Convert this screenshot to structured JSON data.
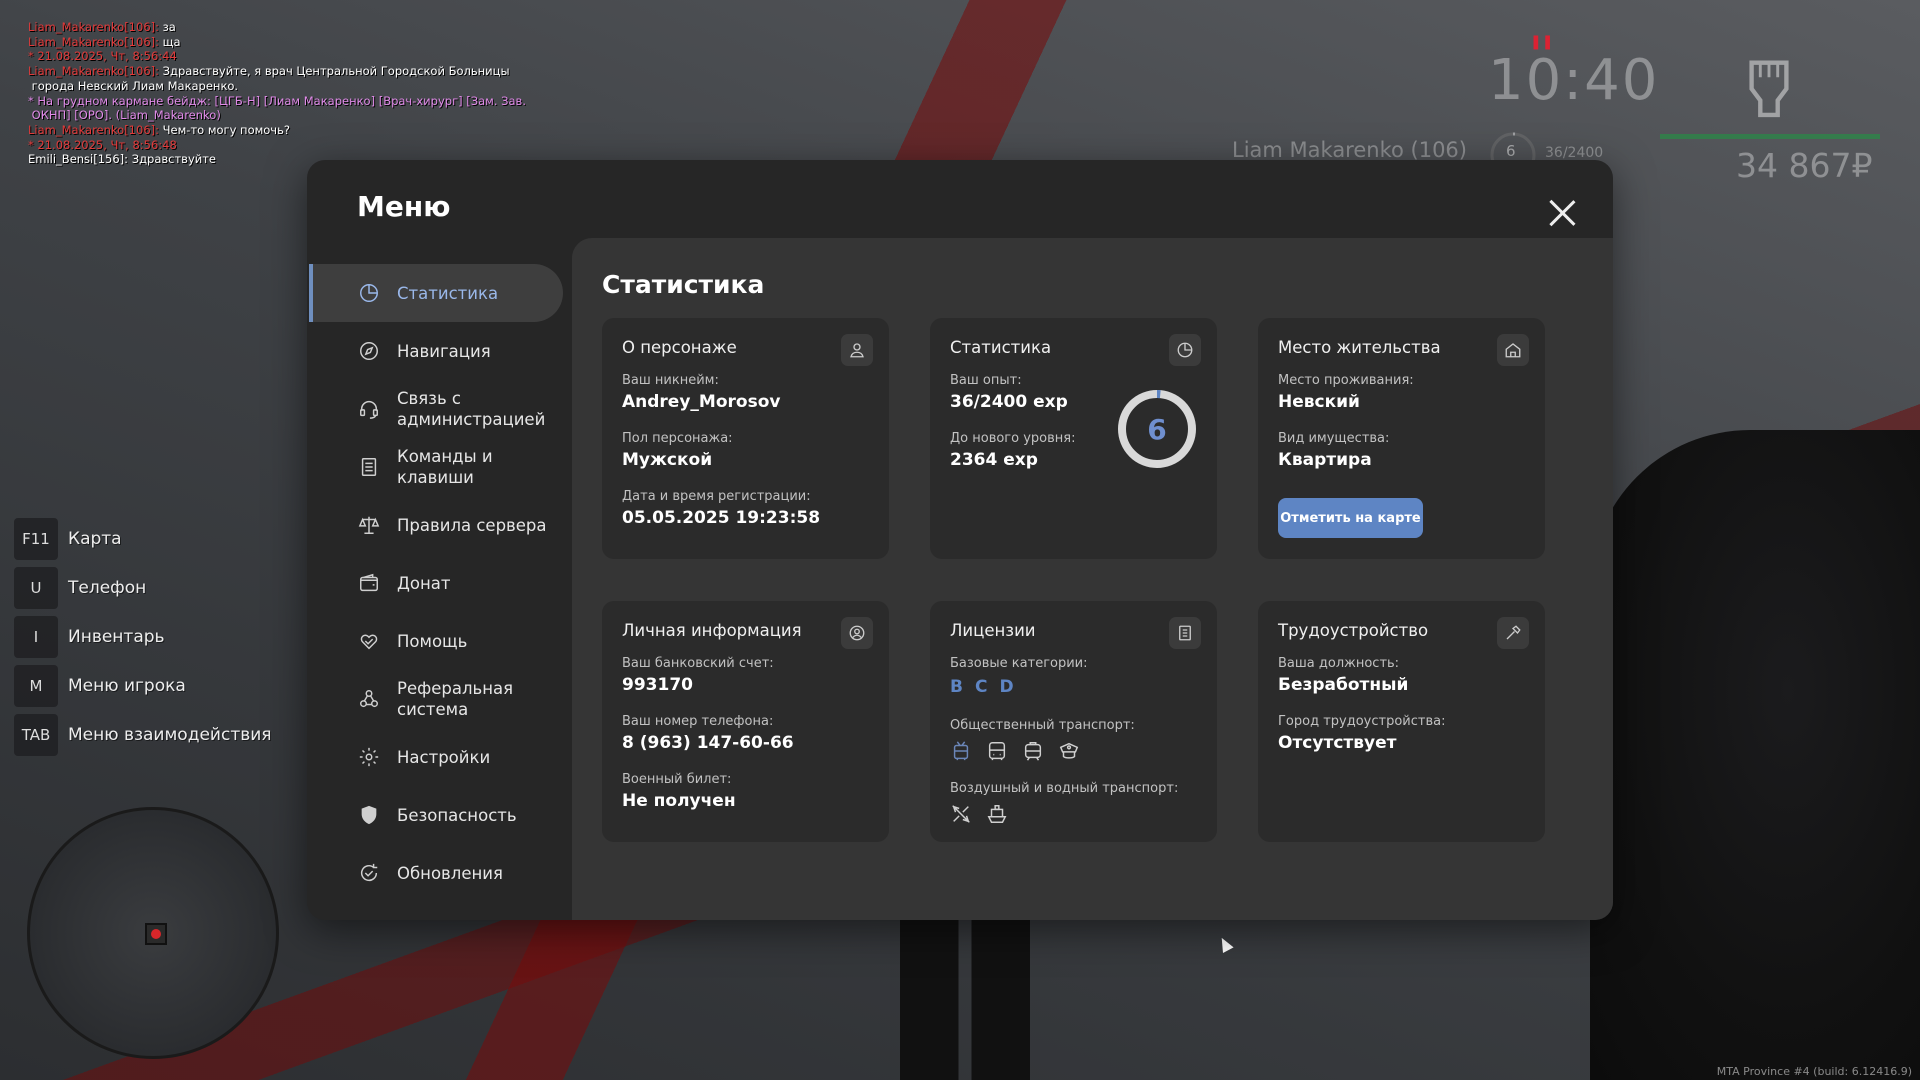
{
  "chat": [
    {
      "parts": [
        {
          "text": "Liam_Makarenko[106]: ",
          "color": "red"
        },
        {
          "text": "за",
          "color": "white"
        }
      ]
    },
    {
      "parts": [
        {
          "text": "Liam_Makarenko[106]: ",
          "color": "red"
        },
        {
          "text": "ща",
          "color": "white"
        }
      ]
    },
    {
      "parts": [
        {
          "text": "* 21.08.2025, Чт, 8:56:44",
          "color": "red"
        }
      ]
    },
    {
      "parts": [
        {
          "text": "Liam_Makarenko[106]: ",
          "color": "red"
        },
        {
          "text": "Здравствуйте, я врач Центральной Городской Больницы",
          "color": "white"
        }
      ]
    },
    {
      "parts": [
        {
          "text": " города Невский Лиам Макаренко.",
          "color": "white"
        }
      ]
    },
    {
      "parts": [
        {
          "text": "* На грудном кармане бейдж: [ЦГБ-Н] [Лиам Макаренко] [Врач-хирург] [Зам. Зав.",
          "color": "pink"
        }
      ]
    },
    {
      "parts": [
        {
          "text": " ОКНП] [ОРО]. (Liam_Makarenko)",
          "color": "pink"
        }
      ]
    },
    {
      "parts": [
        {
          "text": "Liam_Makarenko[106]: ",
          "color": "red"
        },
        {
          "text": "Чем-то могу помочь?",
          "color": "white"
        }
      ]
    },
    {
      "parts": [
        {
          "text": "* 21.08.2025, Чт, 8:56:48",
          "color": "red"
        }
      ]
    },
    {
      "parts": [
        {
          "text": "Emili_Bensi[156]: Здравствуйте",
          "color": "white"
        }
      ]
    }
  ],
  "hud": {
    "clock": "10:40",
    "player_name": "Liam Makarenko (106)",
    "level": "6",
    "exp": "36/2400",
    "money": "34 867₽"
  },
  "hotkeys": [
    {
      "key": "F11",
      "label": "Карта"
    },
    {
      "key": "U",
      "label": "Телефон"
    },
    {
      "key": "I",
      "label": "Инвентарь"
    },
    {
      "key": "M",
      "label": "Меню игрока"
    },
    {
      "key": "TAB",
      "label": "Меню взаимодействия"
    }
  ],
  "build_info": "MTA Province #4 (build: 6.12416.9)",
  "menu": {
    "title": "Меню",
    "sidebar": [
      {
        "label": "Статистика",
        "icon": "pie-chart-icon",
        "active": true
      },
      {
        "label": "Навигация",
        "icon": "compass-icon"
      },
      {
        "label": "Связь с\nадминистрацией",
        "icon": "headset-icon"
      },
      {
        "label": "Команды и\nклавиши",
        "icon": "document-list-icon"
      },
      {
        "label": "Правила сервера",
        "icon": "scales-icon"
      },
      {
        "label": "Донат",
        "icon": "wallet-icon"
      },
      {
        "label": "Помощь",
        "icon": "heart-hands-icon"
      },
      {
        "label": "Реферальная\nсистема",
        "icon": "people-network-icon"
      },
      {
        "label": "Настройки",
        "icon": "gear-icon"
      },
      {
        "label": "Безопасность",
        "icon": "shield-icon"
      },
      {
        "label": "Обновления",
        "icon": "refresh-check-icon"
      }
    ],
    "content_title": "Статистика",
    "cards": {
      "character": {
        "title": "О персонаже",
        "nickname_label": "Ваш никнейм:",
        "nickname": "Andrey_Morosov",
        "gender_label": "Пол персонажа:",
        "gender": "Мужской",
        "reg_label": "Дата и время регистрации:",
        "reg": "05.05.2025 19:23:58"
      },
      "stats": {
        "title": "Статистика",
        "exp_label": "Ваш опыт:",
        "exp": "36/2400 exp",
        "next_label": "До нового уровня:",
        "next": "2364 exp",
        "level": "6",
        "progress": 0.015
      },
      "residence": {
        "title": "Место жительства",
        "place_label": "Место проживания:",
        "place": "Невский",
        "property_label": "Вид имущества:",
        "property": "Квартира",
        "button": "Отметить на карте"
      },
      "personal": {
        "title": "Личная информация",
        "bank_label": "Ваш банковский счет:",
        "bank": "993170",
        "phone_label": "Ваш номер телефона:",
        "phone": "8 (963) 147-60-66",
        "military_label": "Военный билет:",
        "military": "Не получен"
      },
      "licenses": {
        "title": "Лицензии",
        "base_label": "Базовые категории:",
        "base": [
          "B",
          "C",
          "D"
        ],
        "public_label": "Общественный транспорт:",
        "air_label": "Воздушный и водный транспорт:"
      },
      "employment": {
        "title": "Трудоустройство",
        "position_label": "Ваша должность:",
        "position": "Безработный",
        "city_label": "Город трудоустройства:",
        "city": "Отсутствует"
      }
    }
  },
  "colors": {
    "accent": "#5e85c4",
    "panel": "#262626",
    "content": "#353535",
    "card": "#2b2b2b"
  }
}
